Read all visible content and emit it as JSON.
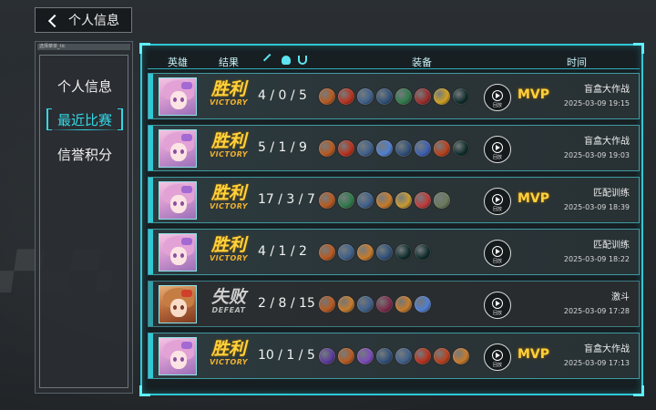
{
  "back_button": {
    "label": "个人信息"
  },
  "nav": {
    "tiny_label": "选择菜单_tic",
    "items": [
      {
        "label": "个人信息",
        "active": false
      },
      {
        "label": "最近比赛",
        "active": true
      },
      {
        "label": "信誉积分",
        "active": false
      }
    ]
  },
  "headers": {
    "hero": "英雄",
    "result": "结果",
    "equipment": "装备",
    "time": "时间"
  },
  "replay_label": "回放",
  "matches": [
    {
      "result": "胜利",
      "result_en": "VICTORY",
      "kda": "4 / 0 / 5",
      "mvp": "MVP",
      "mode": "盲盒大作战",
      "time": "2025-03-09 19:15",
      "items": [
        "#b8591f",
        "#b8301c",
        "#3e5f8a",
        "#2f4f78",
        "#2e7a4a",
        "#9a2b2b",
        "#d0a020",
        "#0e2a2a"
      ]
    },
    {
      "result": "胜利",
      "result_en": "VICTORY",
      "kda": "5 / 1 / 9",
      "mvp": "",
      "mode": "盲盒大作战",
      "time": "2025-03-09 19:03",
      "items": [
        "#b8591f",
        "#b8301c",
        "#3e5f8a",
        "#4f7ed0",
        "#2f4f78",
        "#3c5fb0",
        "#b8401c",
        "#0e2a2a"
      ]
    },
    {
      "result": "胜利",
      "result_en": "VICTORY",
      "kda": "17 / 3 / 7",
      "mvp": "MVP",
      "mode": "匹配训练",
      "time": "2025-03-09 18:39",
      "items": [
        "#b8591f",
        "#2e7a4a",
        "#3e5f8a",
        "#c77a2a",
        "#c79a30",
        "#c03a3a",
        "#6a7a5a"
      ]
    },
    {
      "result": "胜利",
      "result_en": "VICTORY",
      "kda": "4 / 1 / 2",
      "mvp": "",
      "mode": "匹配训练",
      "time": "2025-03-09 18:22",
      "items": [
        "#b8591f",
        "#3e5f8a",
        "#c77a2a",
        "#2f4f78",
        "#0e2a2a",
        "#0e2a2a"
      ]
    },
    {
      "result": "失败",
      "result_en": "DEFEAT",
      "kda": "2 / 8 / 15",
      "mvp": "",
      "mode": "激斗",
      "time": "2025-03-09 17:28",
      "items": [
        "#b8591f",
        "#c77a2a",
        "#3e5f8a",
        "#7a2a4a",
        "#c77a2a",
        "#4f7ed0"
      ]
    },
    {
      "result": "胜利",
      "result_en": "VICTORY",
      "kda": "10 / 1 / 5",
      "mvp": "MVP",
      "mode": "盲盒大作战",
      "time": "2025-03-09 17:13",
      "items": [
        "#5a3a9a",
        "#b8591f",
        "#7a4ab8",
        "#2f4f78",
        "#3e5f8a",
        "#b8301c",
        "#b8401c",
        "#c77a2a"
      ]
    }
  ]
}
